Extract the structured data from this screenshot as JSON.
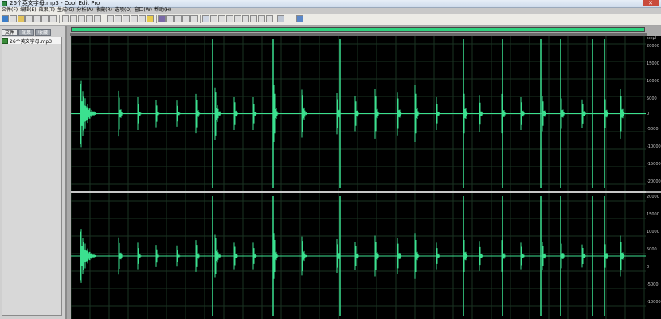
{
  "window": {
    "title": "26个英文字母.mp3 - Cool Edit Pro",
    "close_label": "✕"
  },
  "menu": [
    "文件(F)",
    "编辑(E)",
    "效果(T)",
    "生成(G)",
    "分析(A)",
    "收藏(R)",
    "选项(O)",
    "窗口(W)",
    "帮助(H)"
  ],
  "panel": {
    "tabs": [
      "文件",
      "效果",
      "收藏"
    ],
    "active_tab": 0,
    "files": [
      "26个英文字母.mp3"
    ]
  },
  "editor": {
    "overview_fill_fraction": 1.0,
    "ruler_labels": [
      "smpl",
      "20000",
      "15000",
      "10000",
      "5000",
      "0",
      "-5000",
      "-10000",
      "-15000",
      "-20000"
    ],
    "waveform_color": "#3be08f"
  }
}
